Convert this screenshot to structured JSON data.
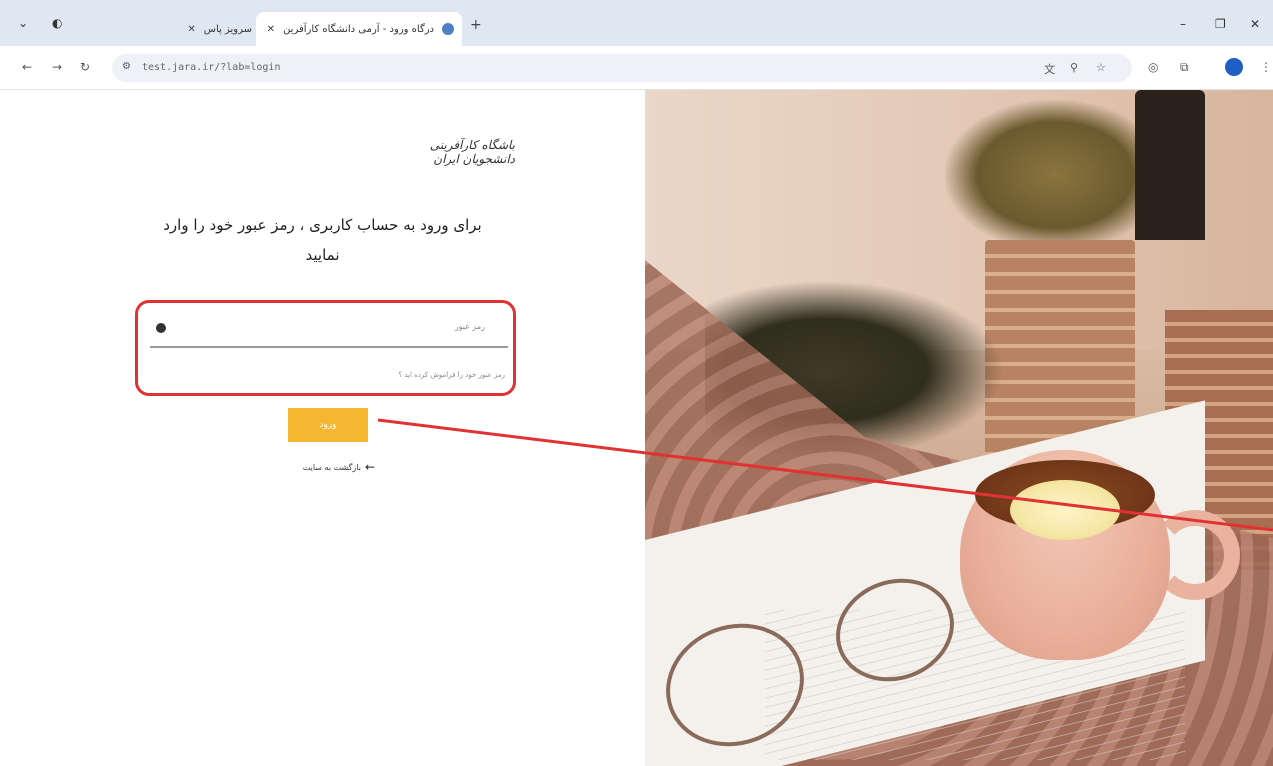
{
  "browser": {
    "tabs": [
      {
        "title": "سرویز پاس",
        "active": false
      },
      {
        "title": "درگاه ورود - آرمی دانشگاه کارآفرین",
        "active": true
      }
    ],
    "url": "test.jara.ir/?lab=login"
  },
  "page": {
    "logo_text": "باشگاه کارآفرینی دانشجویان ایران",
    "heading": "برای ورود به حساب کاربری ، رمز عبور خود را وارد نمایید",
    "password_placeholder": "رمز عبور",
    "forgot_link": "رمز عبور خود را فراموش کرده اید ؟",
    "login_button": "ورود",
    "back_link": "بازگشت به سایت"
  },
  "colors": {
    "login_button": "#f5b731",
    "annotation": "#e03232"
  }
}
